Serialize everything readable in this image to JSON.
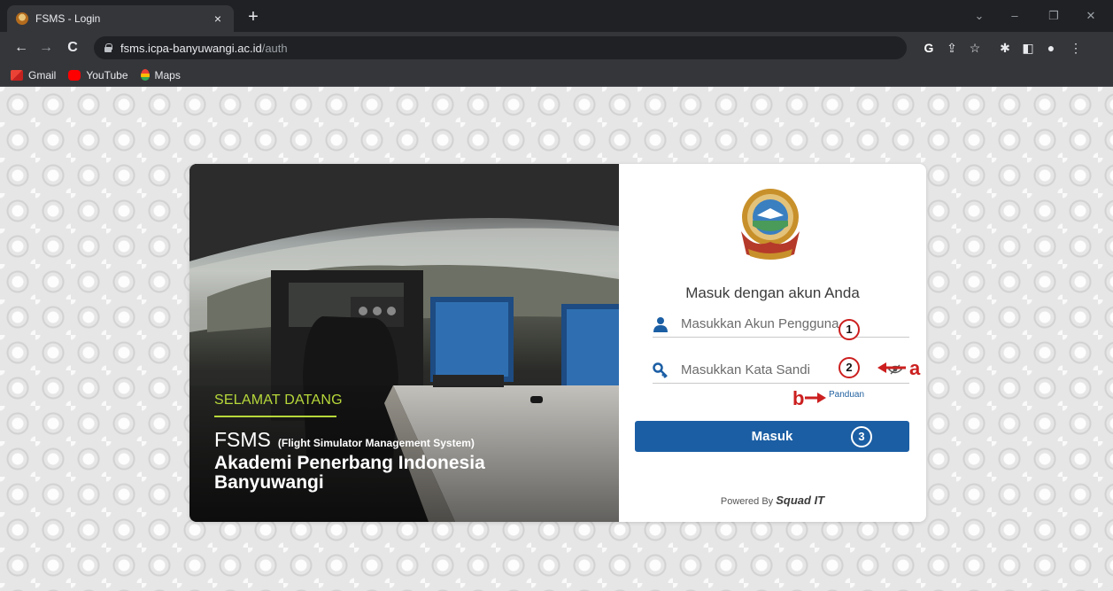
{
  "browser": {
    "tab_title": "FSMS - Login",
    "tab_close": "×",
    "new_tab": "+",
    "url_host": "fsms.icpa-banyuwangi.ac.id",
    "url_path": "/auth",
    "bookmarks": [
      {
        "label": "Gmail",
        "icon": "gmail-icon"
      },
      {
        "label": "YouTube",
        "icon": "youtube-icon"
      },
      {
        "label": "Maps",
        "icon": "maps-icon"
      }
    ]
  },
  "hero": {
    "welcome": "SELAMAT DATANG",
    "app_short": "FSMS",
    "app_full": "(Flight Simulator Management System)",
    "academy": "Akademi Penerbang Indonesia Banyuwangi"
  },
  "login": {
    "title": "Masuk dengan akun Anda",
    "username_placeholder": "Masukkan Akun Pengguna",
    "password_placeholder": "Masukkan Kata Sandi",
    "guide_link": "Panduan",
    "submit_label": "Masuk",
    "powered_by": "Powered By",
    "powered_brand": "Squad IT"
  },
  "annotations": {
    "marker_1": "1",
    "marker_2": "2",
    "marker_3": "3",
    "label_a": "a",
    "label_b": "b"
  },
  "colors": {
    "accent": "#1b5ea4",
    "welcome_green": "#b7d83a",
    "annotation_red": "#cc1f1f"
  }
}
